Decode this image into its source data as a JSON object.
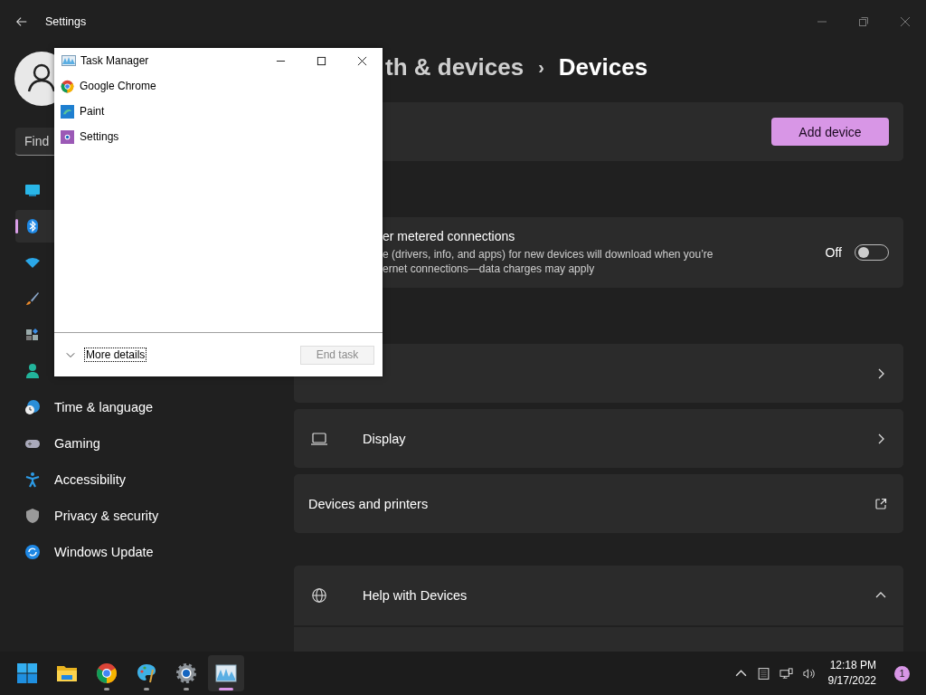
{
  "settings_window": {
    "title": "Settings",
    "search": {
      "placeholder": "Find"
    },
    "nav": [
      {
        "kind": "display",
        "selected": false
      },
      {
        "kind": "bluetooth",
        "selected": true
      },
      {
        "kind": "wifi",
        "selected": false
      },
      {
        "kind": "brush",
        "selected": false
      },
      {
        "kind": "apps",
        "selected": false
      },
      {
        "kind": "account",
        "selected": false
      },
      {
        "kind": "time",
        "label": "Time & language",
        "selected": false
      },
      {
        "kind": "gaming",
        "label": "Gaming",
        "selected": false
      },
      {
        "kind": "accessibility",
        "label": "Accessibility",
        "selected": false
      },
      {
        "kind": "privacy",
        "label": "Privacy & security",
        "selected": false
      },
      {
        "kind": "update",
        "label": "Windows Update",
        "selected": false
      }
    ],
    "breadcrumb": {
      "parent": "th & devices",
      "separator": "›",
      "current": "Devices"
    },
    "add_device_button": "Add device",
    "metered": {
      "title": "er metered connections",
      "description": "e (drivers, info, and apps) for new devices will download when you’re",
      "description_2": "ernet connections—data charges may apply",
      "state_label": "Off",
      "on": false
    },
    "rows": [
      {
        "kind": "sound"
      },
      {
        "kind": "display",
        "label": "Display"
      },
      {
        "kind": "external",
        "label": "Devices and printers"
      }
    ],
    "help": {
      "title": "Help with Devices",
      "expanded": true
    }
  },
  "task_manager": {
    "title": "Task Manager",
    "apps": [
      {
        "kind": "chrome",
        "name": "Google Chrome"
      },
      {
        "kind": "paint",
        "name": "Paint"
      },
      {
        "kind": "settings",
        "name": "Settings"
      }
    ],
    "more_details": "More details",
    "end_task": {
      "label": "End task",
      "disabled": true
    }
  },
  "taskbar": {
    "apps": [
      {
        "kind": "start",
        "running": false,
        "active": false
      },
      {
        "kind": "explorer",
        "running": false,
        "active": false
      },
      {
        "kind": "chrome",
        "running": true,
        "active": false
      },
      {
        "kind": "paint",
        "running": true,
        "active": false
      },
      {
        "kind": "settings",
        "running": true,
        "active": false
      },
      {
        "kind": "taskmanager",
        "running": true,
        "active": true
      }
    ],
    "time": "12:18 PM",
    "date": "9/17/2022",
    "notification_count": "1"
  }
}
